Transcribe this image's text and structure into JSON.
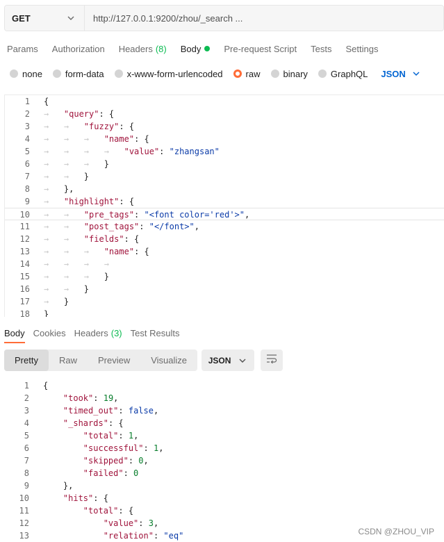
{
  "request": {
    "method": "GET",
    "url": "http://127.0.0.1:9200/zhou/_search ..."
  },
  "request_tabs": [
    {
      "label": "Params"
    },
    {
      "label": "Authorization"
    },
    {
      "label": "Headers",
      "count": "(8)"
    },
    {
      "label": "Body"
    },
    {
      "label": "Pre-request Script"
    },
    {
      "label": "Tests"
    },
    {
      "label": "Settings"
    }
  ],
  "body_types": {
    "options": [
      "none",
      "form-data",
      "x-www-form-urlencoded",
      "raw",
      "binary",
      "GraphQL"
    ],
    "selected": "raw",
    "format": "JSON"
  },
  "request_body_lines": [
    "1",
    "2",
    "3",
    "4",
    "5",
    "6",
    "7",
    "8",
    "9",
    "10",
    "11",
    "12",
    "13",
    "14",
    "15",
    "16",
    "17",
    "18"
  ],
  "response_tabs": [
    {
      "label": "Body"
    },
    {
      "label": "Cookies"
    },
    {
      "label": "Headers",
      "count": "(3)"
    },
    {
      "label": "Test Results"
    }
  ],
  "response_view": {
    "modes": [
      "Pretty",
      "Raw",
      "Preview",
      "Visualize"
    ],
    "selected_mode": "Pretty",
    "format": "JSON"
  },
  "response_body_lines": [
    "1",
    "2",
    "3",
    "4",
    "5",
    "6",
    "7",
    "8",
    "9",
    "10",
    "11",
    "12",
    "13"
  ],
  "code": {
    "query": "\"query\"",
    "fuzzy": "\"fuzzy\"",
    "name": "\"name\"",
    "value": "\"value\"",
    "zhangsan": "\"zhangsan\"",
    "highlight": "\"highlight\"",
    "pre_tags": "\"pre_tags\"",
    "pre_tags_val": "\"<font color='red'>\"",
    "post_tags": "\"post_tags\"",
    "post_tags_val": "\"</font>\"",
    "fields": "\"fields\"",
    "took": "\"took\"",
    "took_val": "19",
    "timed_out": "\"timed_out\"",
    "timed_out_val": "false",
    "shards": "\"_shards\"",
    "total": "\"total\"",
    "total_val": "1",
    "successful": "\"successful\"",
    "successful_val": "1",
    "skipped": "\"skipped\"",
    "skipped_val": "0",
    "failed": "\"failed\"",
    "failed_val": "0",
    "hits": "\"hits\"",
    "value_val": "3",
    "relation": "\"relation\"",
    "relation_val": "\"eq\""
  },
  "watermark": "CSDN @ZHOU_VIP",
  "colors": {
    "accent": "#ff6c37",
    "count_green": "#0cbb52",
    "json_blue": "#0265d2",
    "key": "#a0143c",
    "string": "#0b3ba8",
    "number": "#077d2b"
  },
  "icons": {
    "method_dropdown": "chevron-down-icon",
    "format_dropdown": "chevron-down-icon",
    "wrap": "wrap-lines-icon"
  }
}
